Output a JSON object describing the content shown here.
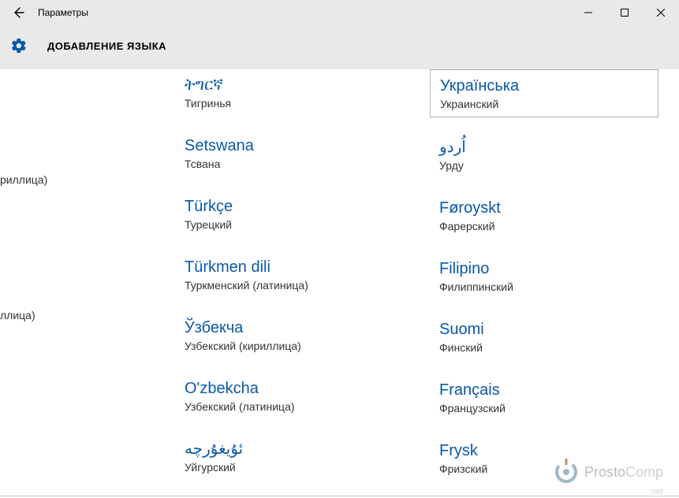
{
  "window": {
    "title": "Параметры"
  },
  "header": {
    "page_title": "ДОБАВЛЕНИЕ ЯЗЫКА"
  },
  "cutoff": [
    {
      "local": "риллица)"
    },
    {
      "local": "ллица)"
    }
  ],
  "left": [
    {
      "native": "ትግርኛ",
      "local": "Тигринья"
    },
    {
      "native": "Setswana",
      "local": "Тсвана"
    },
    {
      "native": "Türkçe",
      "local": "Турецкий"
    },
    {
      "native": "Türkmen dili",
      "local": "Туркменский (латиница)"
    },
    {
      "native": "Ўзбекча",
      "local": "Узбекский (кириллица)"
    },
    {
      "native": "O'zbekcha",
      "local": "Узбекский (латиница)"
    },
    {
      "native": "ئۇيغۇرچە",
      "local": "Уйгурский"
    }
  ],
  "right": [
    {
      "native": "Українська",
      "local": "Украинский",
      "selected": true
    },
    {
      "native": "اُردو",
      "local": "Урду"
    },
    {
      "native": "Føroyskt",
      "local": "Фарерский"
    },
    {
      "native": "Filipino",
      "local": "Филиппинский"
    },
    {
      "native": "Suomi",
      "local": "Финский"
    },
    {
      "native": "Français",
      "local": "Французский"
    },
    {
      "native": "Frysk",
      "local": "Фризский"
    }
  ],
  "watermark": {
    "a": "Prosto",
    "b": "Comp",
    "sub": ".net"
  }
}
